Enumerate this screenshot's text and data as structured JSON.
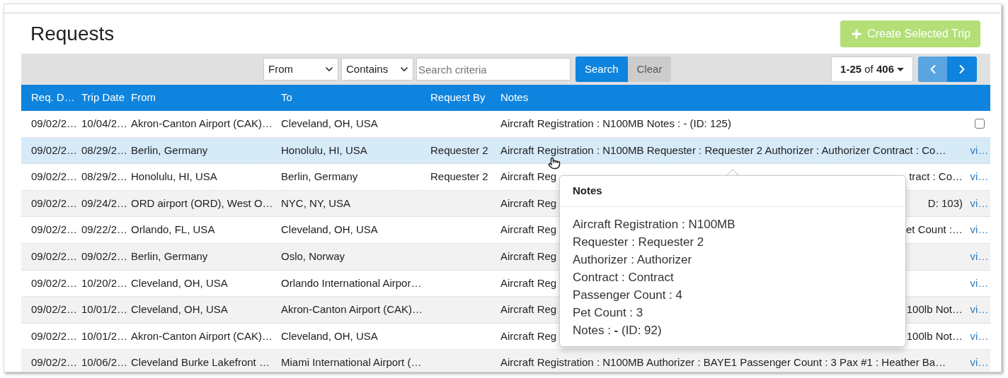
{
  "page": {
    "title": "Requests"
  },
  "create_button": {
    "label": "Create Selected Trip",
    "disabled": true
  },
  "toolbar": {
    "field_select": "From",
    "operator_select": "Contains",
    "search": {
      "placeholder": "Search criteria"
    },
    "search_button": "Search",
    "clear_button": "Clear",
    "pager": "**1-25** of **406**",
    "prev_disabled": true
  },
  "table": {
    "columns": [
      "Req. D…",
      "Trip Date",
      "From",
      "To",
      "Request By",
      "Notes"
    ],
    "rows": [
      {
        "req_date": "09/02/2…",
        "trip_date": "10/04/2…",
        "from": "Akron-Canton Airport (CAK)…",
        "to": "Cleveland, OH, USA",
        "request_by": "",
        "notes": "Aircraft Registration : N100MB Notes : - (ID: 125)",
        "selected": false,
        "kind": "checkbox",
        "checked": false
      },
      {
        "req_date": "09/02/2…",
        "trip_date": "08/29/2…",
        "from": "Berlin, Germany",
        "to": "Honolulu, HI, USA",
        "request_by": "Requester 2",
        "notes": "Aircraft Registration : N100MB Requester : Requester 2 Authorizer : Authorizer Contract : Co…",
        "selected": true,
        "kind": "link",
        "link": "vi…"
      },
      {
        "req_date": "09/02/2…",
        "trip_date": "08/29/2…",
        "from": "Honolulu, HI, USA",
        "to": "Berlin, Germany",
        "request_by": "Requester 2",
        "notes": "Aircraft Reg",
        "notes_tail": "tract : Co…",
        "selected": false,
        "kind": "link",
        "link": "vi…"
      },
      {
        "req_date": "09/02/2…",
        "trip_date": "09/24/2…",
        "from": "ORD airport (ORD), West O…",
        "to": "NYC, NY, USA",
        "request_by": "",
        "notes": "Aircraft Reg",
        "notes_tail": "D: 103)",
        "selected": false,
        "kind": "link",
        "link": "vi…"
      },
      {
        "req_date": "09/02/2…",
        "trip_date": "09/22/2…",
        "from": "Orlando, FL, USA",
        "to": "Cleveland, OH, USA",
        "request_by": "",
        "notes": "Aircraft Reg",
        "notes_tail": "et Count :…",
        "selected": false,
        "kind": "link",
        "link": "vi…"
      },
      {
        "req_date": "09/02/2…",
        "trip_date": "09/02/2…",
        "from": "Berlin, Germany",
        "to": "Oslo, Norway",
        "request_by": "",
        "notes": "Aircraft Reg",
        "selected": false,
        "kind": "link",
        "link": "vi…"
      },
      {
        "req_date": "09/02/2…",
        "trip_date": "10/20/2…",
        "from": "Cleveland, OH, USA",
        "to": "Orlando International Airpor…",
        "request_by": "",
        "notes": "Aircraft Reg",
        "selected": false,
        "kind": "link",
        "link": "vi…"
      },
      {
        "req_date": "09/02/2…",
        "trip_date": "10/01/2…",
        "from": "Cleveland, OH, USA",
        "to": "Akron-Canton Airport (CAK)…",
        "request_by": "",
        "notes": "Aircraft Reg",
        "notes_tail": "100lb Not…",
        "selected": false,
        "kind": "link",
        "link": "vi…"
      },
      {
        "req_date": "09/02/2…",
        "trip_date": "10/01/2…",
        "from": "Akron-Canton Airport (CAK)…",
        "to": "Cleveland, OH, USA",
        "request_by": "",
        "notes": "Aircraft Reg",
        "notes_tail": "100lb Not…",
        "selected": false,
        "kind": "link",
        "link": "vi…"
      },
      {
        "req_date": "09/02/2…",
        "trip_date": "10/06/2…",
        "from": "Cleveland Burke Lakefront …",
        "to": "Miami International Airport (…",
        "request_by": "",
        "notes": "Aircraft Registration : N100MB Authorizer : BAYE1 Passenger Count : 3 Pax #1 : Heather Ba…",
        "selected": false,
        "kind": "link",
        "link": "vi…"
      }
    ]
  },
  "popover": {
    "title": "Notes",
    "lines": [
      "Aircraft Registration : N100MB",
      "Requester : Requester 2",
      "Authorizer : Authorizer",
      "Contract : Contract",
      "Passenger Count : 4",
      "Pet Count : 3",
      "Notes : **-** (ID: 92)"
    ]
  }
}
